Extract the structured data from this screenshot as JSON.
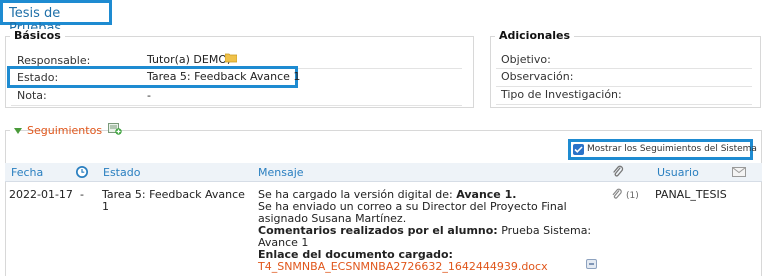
{
  "page_title": "Tesis de Pruebas",
  "basicos": {
    "legend": "Básicos",
    "responsable_label": "Responsable:",
    "responsable_value": "Tutor(a) DEMO,",
    "estado_label": "Estado:",
    "estado_value": "Tarea 5: Feedback Avance 1",
    "nota_label": "Nota:",
    "nota_value": "-"
  },
  "adicionales": {
    "legend": "Adicionales",
    "objetivo_label": "Objetivo:",
    "observacion_label": "Observación:",
    "tipo_label": "Tipo de Investigación:"
  },
  "seguimientos": {
    "title": "Seguimientos",
    "checkbox_label": "Mostrar los Seguimientos del Sistema",
    "checkbox_checked": true,
    "columns": {
      "fecha": "Fecha",
      "estado": "Estado",
      "mensaje": "Mensaje",
      "usuario": "Usuario"
    },
    "rows": [
      {
        "fecha": "2022-01-17",
        "dash": "-",
        "estado_line1": "Tarea 5: Feedback Avance",
        "estado_line2": "1",
        "msg_pre": "Se ha cargado la versión digital de:",
        "msg_bold": "Avance 1.",
        "msg_line2": "Se ha enviado un correo a su Director del Proyecto Final",
        "msg_line3": "asignado Susana Martínez.",
        "msg_comments_label": "Comentarios realizados por el alumno:",
        "msg_comments_value": "Prueba Sistema:",
        "msg_comments_value2": "Avance 1",
        "msg_link_label": "Enlace del documento cargado:",
        "msg_link": "T4_SNMNBA_ECSNMNBA2726632_1642444939.docx",
        "attach_count": "(1)",
        "usuario": "PANAL_TESIS"
      }
    ]
  },
  "colors": {
    "accent_blue": "#1e8bd1",
    "link_orange": "#e0561b",
    "header_blue": "#2a7fc0"
  }
}
